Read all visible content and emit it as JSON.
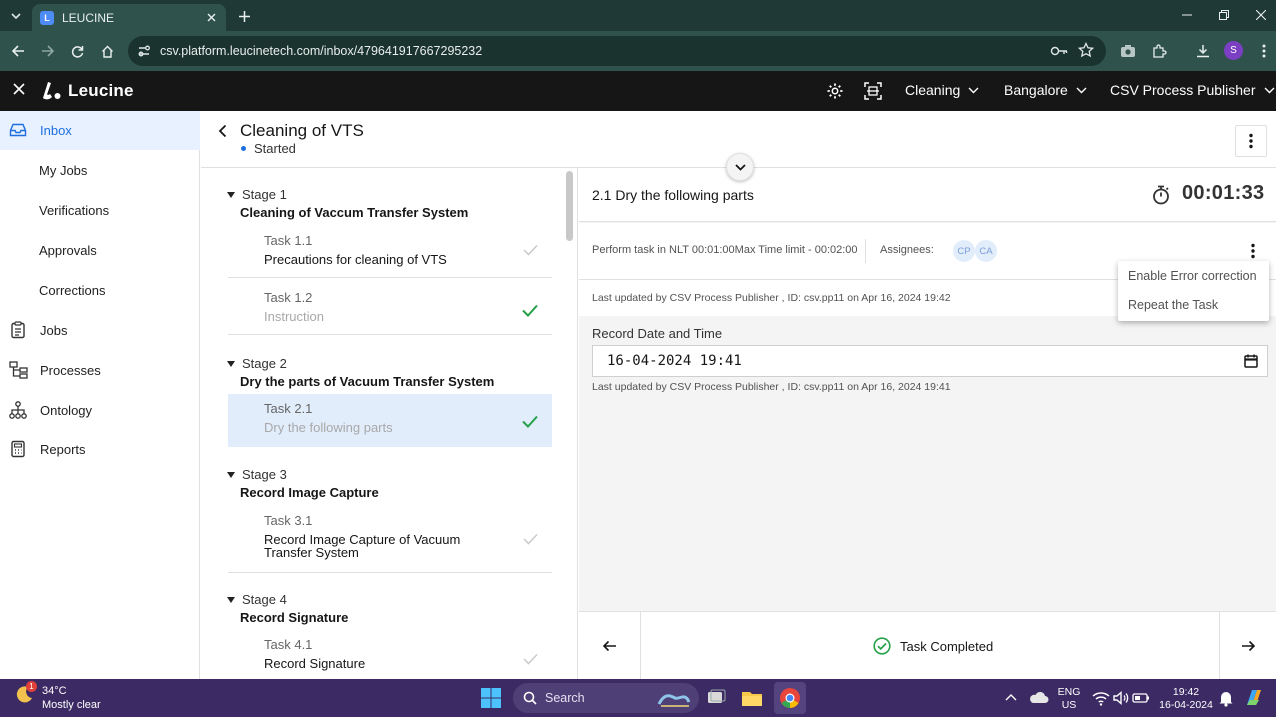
{
  "browser": {
    "tab_title": "LEUCINE",
    "url": "csv.platform.leucinetech.com/inbox/479641917667295232"
  },
  "app": {
    "brand": "Leucine",
    "facility_dropdown": "Cleaning",
    "site_dropdown": "Bangalore",
    "role_dropdown": "CSV Process Publisher"
  },
  "sidebar": {
    "items": [
      {
        "label": "Inbox"
      },
      {
        "label": "My Jobs"
      },
      {
        "label": "Verifications"
      },
      {
        "label": "Approvals"
      },
      {
        "label": "Corrections"
      },
      {
        "label": "Jobs"
      },
      {
        "label": "Processes"
      },
      {
        "label": "Ontology"
      },
      {
        "label": "Reports"
      }
    ]
  },
  "job": {
    "title": "Cleaning of VTS",
    "status": "Started"
  },
  "stages": [
    {
      "num": "Stage 1",
      "name": "Cleaning of Vaccum Transfer System",
      "tasks": [
        {
          "num": "Task 1.1",
          "name": "Precautions for cleaning of VTS"
        },
        {
          "num": "Task 1.2",
          "name": "Instruction"
        }
      ]
    },
    {
      "num": "Stage 2",
      "name": "Dry the parts of Vacuum Transfer System",
      "tasks": [
        {
          "num": "Task 2.1",
          "name": "Dry the following parts"
        }
      ]
    },
    {
      "num": "Stage 3",
      "name": "Record Image Capture",
      "tasks": [
        {
          "num": "Task 3.1",
          "name": "Record Image Capture of Vacuum Transfer System"
        }
      ]
    },
    {
      "num": "Stage 4",
      "name": "Record Signature",
      "tasks": [
        {
          "num": "Task 4.1",
          "name": "Record Signature"
        }
      ]
    }
  ],
  "task": {
    "title": "2.1 Dry the following parts",
    "timer": "00:01:33",
    "timing": "Perform task in NLT 00:01:00Max Time limit - 00:02:00",
    "assignees_label": "Assignees:",
    "assignees": [
      "CP",
      "CA"
    ],
    "last_updated_task": "Last updated by CSV Process Publisher , ID: csv.pp11 on Apr 16, 2024 19:42",
    "field_label": "Record Date and Time",
    "field_value": "16-04-2024 19:41",
    "last_updated_field": "Last updated by CSV Process Publisher , ID: csv.pp11 on Apr 16, 2024 19:41",
    "menu": [
      "Enable Error correction",
      "Repeat the Task"
    ],
    "completed_label": "Task Completed"
  },
  "taskbar": {
    "temp": "34°C",
    "weather": "Mostly clear",
    "weather_badge": "1",
    "search_placeholder": "Search",
    "lang_1": "ENG",
    "lang_2": "US",
    "time": "19:42",
    "date": "16-04-2024"
  },
  "colors": {
    "accent": "#1d6fe0",
    "success": "#24a148",
    "app_header": "#161616",
    "browser_frame": "#2f524c",
    "taskbar": "#3b2a63"
  }
}
